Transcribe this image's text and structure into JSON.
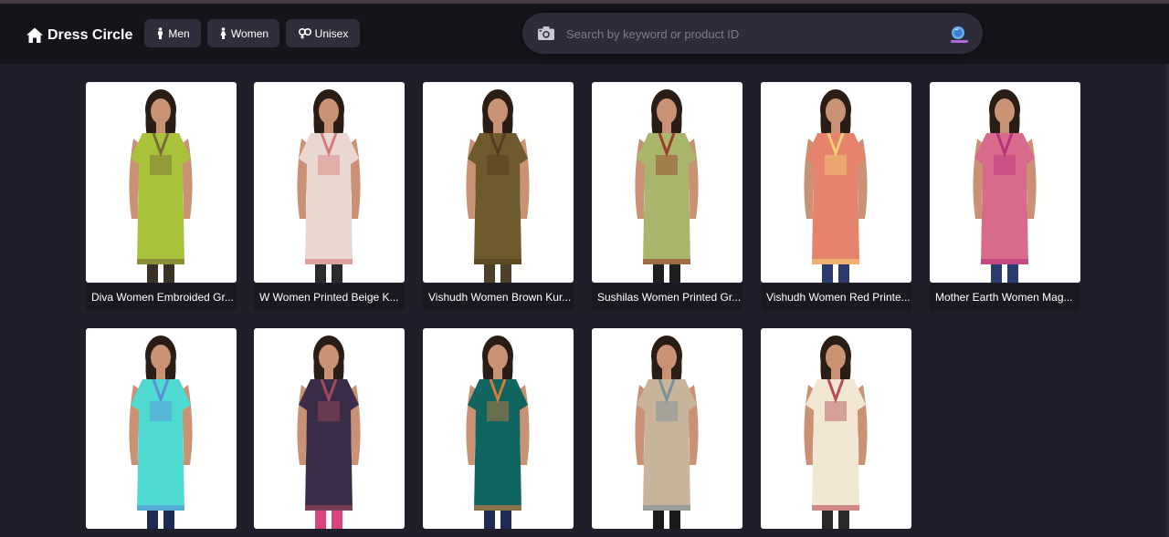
{
  "header": {
    "brand": "Dress Circle",
    "nav": [
      {
        "label": "Men"
      },
      {
        "label": "Women"
      },
      {
        "label": "Unisex"
      }
    ],
    "search": {
      "placeholder": "Search by keyword or product ID"
    }
  },
  "products": [
    {
      "title": "Diva Women Embroided Gr...",
      "dress_color": "#a8c23a",
      "accent": "#7b6b3a",
      "legs": "#3b3226"
    },
    {
      "title": "W Women Printed Beige K...",
      "dress_color": "#e9d8cf",
      "accent": "#d97a7a",
      "legs": "#2b2b2b"
    },
    {
      "title": "Vishudh Women Brown Kur...",
      "dress_color": "#6e5a2c",
      "accent": "#4f3f1d",
      "legs": "#4e3f2a"
    },
    {
      "title": "Sushilas Women Printed Gr...",
      "dress_color": "#a9b56b",
      "accent": "#9c3b2b",
      "legs": "#1f1f1f"
    },
    {
      "title": "Vishudh Women Red Printe...",
      "dress_color": "#e5836c",
      "accent": "#f0d070",
      "legs": "#2d3a6e"
    },
    {
      "title": "Mother Earth Women Mag...",
      "dress_color": "#d86a8c",
      "accent": "#b8327c",
      "legs": "#2a3b6e"
    },
    {
      "title": "",
      "dress_color": "#4fd9d0",
      "accent": "#5a8fd6",
      "legs": "#1d2a52"
    },
    {
      "title": "",
      "dress_color": "#3b2c48",
      "accent": "#a14a5e",
      "legs": "#d8457e"
    },
    {
      "title": "",
      "dress_color": "#106560",
      "accent": "#d87a3a",
      "legs": "#1f2a55"
    },
    {
      "title": "",
      "dress_color": "#c8b49a",
      "accent": "#7a8f9a",
      "legs": "#1a1a1a"
    },
    {
      "title": "",
      "dress_color": "#f1e6d2",
      "accent": "#b84a5a",
      "legs": "#2a2a2a"
    }
  ]
}
